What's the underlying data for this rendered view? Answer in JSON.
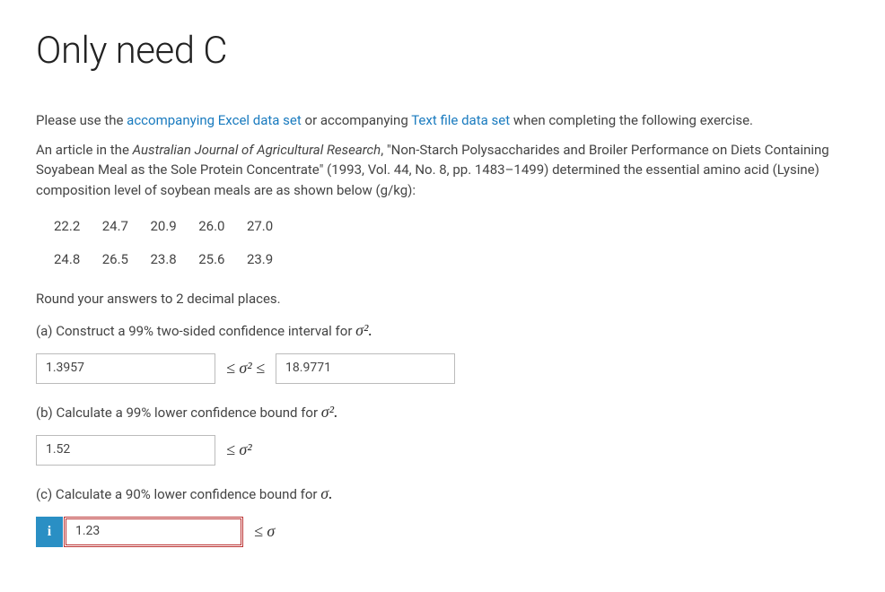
{
  "title": "Only need C",
  "intro": {
    "prefix": "Please use the ",
    "link1": "accompanying Excel data set",
    "mid": " or accompanying ",
    "link2": "Text file data set",
    "suffix": " when completing the following exercise."
  },
  "article": {
    "prefix": "An article in the ",
    "journal": "Australian Journal of Agricultural Research",
    "rest": ", \"Non-Starch Polysaccharides and Broiler Performance on Diets Containing Soyabean Meal as the Sole Protein Concentrate\" (1993, Vol. 44, No. 8, pp. 1483–1499) determined the essential amino acid (Lysine) composition level of soybean meals are as shown below (g/kg):"
  },
  "data": {
    "row1": [
      "22.2",
      "24.7",
      "20.9",
      "26.0",
      "27.0"
    ],
    "row2": [
      "24.8",
      "26.5",
      "23.8",
      "25.6",
      "23.9"
    ]
  },
  "round_note": "Round your answers to 2 decimal places.",
  "parts": {
    "a": {
      "prompt_prefix": "(a) Construct a 99% two-sided confidence interval for ",
      "lower": "1.3957",
      "upper": "18.9771"
    },
    "b": {
      "prompt_prefix": "(b) Calculate a 99% lower confidence bound for ",
      "lower": "1.52"
    },
    "c": {
      "prompt_prefix": "(c) Calculate a 90% lower confidence bound for ",
      "lower": "1.23"
    }
  },
  "symbols": {
    "leq_sigma2_leq": "≤ σ² ≤",
    "leq_sigma2": "≤ σ²",
    "leq_sigma": "≤ σ",
    "sigma2_dot": "σ².",
    "sigma_dot": "σ.",
    "info": "i"
  }
}
